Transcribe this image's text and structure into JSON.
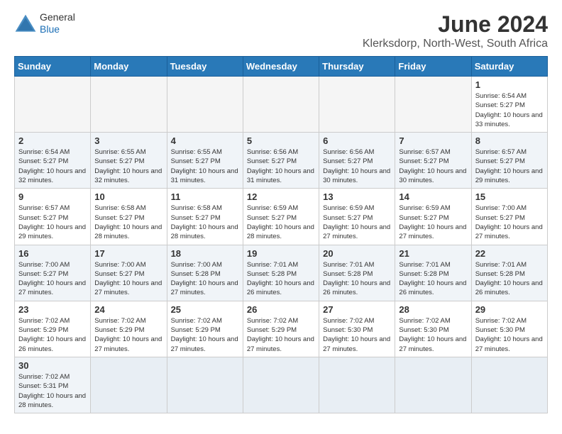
{
  "logo": {
    "line1": "General",
    "line2": "Blue"
  },
  "title": "June 2024",
  "subtitle": "Klerksdorp, North-West, South Africa",
  "weekdays": [
    "Sunday",
    "Monday",
    "Tuesday",
    "Wednesday",
    "Thursday",
    "Friday",
    "Saturday"
  ],
  "weeks": [
    [
      {
        "day": "",
        "info": ""
      },
      {
        "day": "",
        "info": ""
      },
      {
        "day": "",
        "info": ""
      },
      {
        "day": "",
        "info": ""
      },
      {
        "day": "",
        "info": ""
      },
      {
        "day": "",
        "info": ""
      },
      {
        "day": "1",
        "info": "Sunrise: 6:54 AM\nSunset: 5:27 PM\nDaylight: 10 hours\nand 33 minutes."
      }
    ],
    [
      {
        "day": "2",
        "info": "Sunrise: 6:54 AM\nSunset: 5:27 PM\nDaylight: 10 hours\nand 32 minutes."
      },
      {
        "day": "3",
        "info": "Sunrise: 6:55 AM\nSunset: 5:27 PM\nDaylight: 10 hours\nand 32 minutes."
      },
      {
        "day": "4",
        "info": "Sunrise: 6:55 AM\nSunset: 5:27 PM\nDaylight: 10 hours\nand 31 minutes."
      },
      {
        "day": "5",
        "info": "Sunrise: 6:56 AM\nSunset: 5:27 PM\nDaylight: 10 hours\nand 31 minutes."
      },
      {
        "day": "6",
        "info": "Sunrise: 6:56 AM\nSunset: 5:27 PM\nDaylight: 10 hours\nand 30 minutes."
      },
      {
        "day": "7",
        "info": "Sunrise: 6:57 AM\nSunset: 5:27 PM\nDaylight: 10 hours\nand 30 minutes."
      },
      {
        "day": "8",
        "info": "Sunrise: 6:57 AM\nSunset: 5:27 PM\nDaylight: 10 hours\nand 29 minutes."
      }
    ],
    [
      {
        "day": "9",
        "info": "Sunrise: 6:57 AM\nSunset: 5:27 PM\nDaylight: 10 hours\nand 29 minutes."
      },
      {
        "day": "10",
        "info": "Sunrise: 6:58 AM\nSunset: 5:27 PM\nDaylight: 10 hours\nand 28 minutes."
      },
      {
        "day": "11",
        "info": "Sunrise: 6:58 AM\nSunset: 5:27 PM\nDaylight: 10 hours\nand 28 minutes."
      },
      {
        "day": "12",
        "info": "Sunrise: 6:59 AM\nSunset: 5:27 PM\nDaylight: 10 hours\nand 28 minutes."
      },
      {
        "day": "13",
        "info": "Sunrise: 6:59 AM\nSunset: 5:27 PM\nDaylight: 10 hours\nand 27 minutes."
      },
      {
        "day": "14",
        "info": "Sunrise: 6:59 AM\nSunset: 5:27 PM\nDaylight: 10 hours\nand 27 minutes."
      },
      {
        "day": "15",
        "info": "Sunrise: 7:00 AM\nSunset: 5:27 PM\nDaylight: 10 hours\nand 27 minutes."
      }
    ],
    [
      {
        "day": "16",
        "info": "Sunrise: 7:00 AM\nSunset: 5:27 PM\nDaylight: 10 hours\nand 27 minutes."
      },
      {
        "day": "17",
        "info": "Sunrise: 7:00 AM\nSunset: 5:27 PM\nDaylight: 10 hours\nand 27 minutes."
      },
      {
        "day": "18",
        "info": "Sunrise: 7:00 AM\nSunset: 5:28 PM\nDaylight: 10 hours\nand 27 minutes."
      },
      {
        "day": "19",
        "info": "Sunrise: 7:01 AM\nSunset: 5:28 PM\nDaylight: 10 hours\nand 26 minutes."
      },
      {
        "day": "20",
        "info": "Sunrise: 7:01 AM\nSunset: 5:28 PM\nDaylight: 10 hours\nand 26 minutes."
      },
      {
        "day": "21",
        "info": "Sunrise: 7:01 AM\nSunset: 5:28 PM\nDaylight: 10 hours\nand 26 minutes."
      },
      {
        "day": "22",
        "info": "Sunrise: 7:01 AM\nSunset: 5:28 PM\nDaylight: 10 hours\nand 26 minutes."
      }
    ],
    [
      {
        "day": "23",
        "info": "Sunrise: 7:02 AM\nSunset: 5:29 PM\nDaylight: 10 hours\nand 26 minutes."
      },
      {
        "day": "24",
        "info": "Sunrise: 7:02 AM\nSunset: 5:29 PM\nDaylight: 10 hours\nand 27 minutes."
      },
      {
        "day": "25",
        "info": "Sunrise: 7:02 AM\nSunset: 5:29 PM\nDaylight: 10 hours\nand 27 minutes."
      },
      {
        "day": "26",
        "info": "Sunrise: 7:02 AM\nSunset: 5:29 PM\nDaylight: 10 hours\nand 27 minutes."
      },
      {
        "day": "27",
        "info": "Sunrise: 7:02 AM\nSunset: 5:30 PM\nDaylight: 10 hours\nand 27 minutes."
      },
      {
        "day": "28",
        "info": "Sunrise: 7:02 AM\nSunset: 5:30 PM\nDaylight: 10 hours\nand 27 minutes."
      },
      {
        "day": "29",
        "info": "Sunrise: 7:02 AM\nSunset: 5:30 PM\nDaylight: 10 hours\nand 27 minutes."
      }
    ],
    [
      {
        "day": "30",
        "info": "Sunrise: 7:02 AM\nSunset: 5:31 PM\nDaylight: 10 hours\nand 28 minutes."
      },
      {
        "day": "",
        "info": ""
      },
      {
        "day": "",
        "info": ""
      },
      {
        "day": "",
        "info": ""
      },
      {
        "day": "",
        "info": ""
      },
      {
        "day": "",
        "info": ""
      },
      {
        "day": "",
        "info": ""
      }
    ]
  ]
}
